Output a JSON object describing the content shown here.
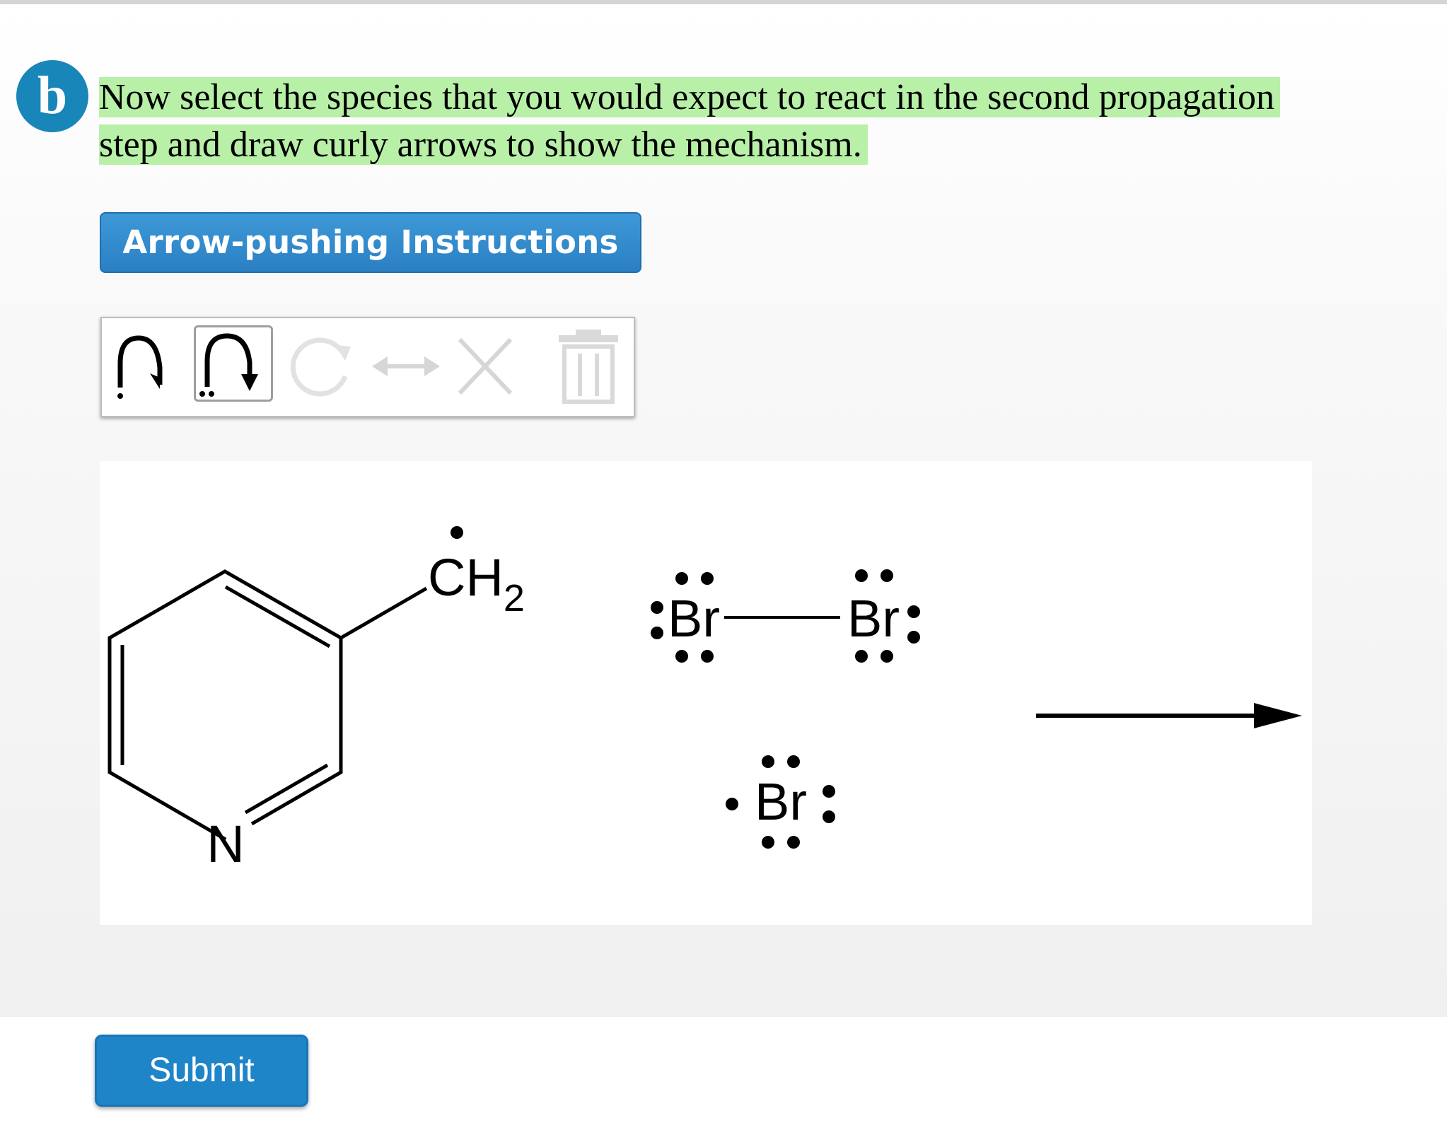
{
  "question": {
    "part_label": "b",
    "prompt_line1": "Now select the species that you would expect to react in the second propagation",
    "prompt_line2": "step and draw curly arrows to show the mechanism.",
    "highlight_color": "#b8f0a8"
  },
  "instructions_button": {
    "label": "Arrow-pushing Instructions"
  },
  "toolbar": {
    "tools": [
      {
        "name": "single-electron-arrow",
        "icon": "fishhook-arrow-icon",
        "enabled": true,
        "selected": false
      },
      {
        "name": "electron-pair-arrow",
        "icon": "curved-arrow-icon",
        "enabled": true,
        "selected": true
      },
      {
        "name": "rotate",
        "icon": "rotate-icon",
        "enabled": false,
        "selected": false
      },
      {
        "name": "resonance",
        "icon": "double-headed-arrow-icon",
        "enabled": false,
        "selected": false
      },
      {
        "name": "delete",
        "icon": "x-icon",
        "enabled": false,
        "selected": false
      },
      {
        "name": "clear",
        "icon": "trash-icon",
        "enabled": false,
        "selected": false
      }
    ]
  },
  "canvas": {
    "species": [
      {
        "name": "3-pyridylmethyl radical",
        "ring_atom": "N",
        "substituent": "CH",
        "substituent_subscript": "2"
      },
      {
        "name": "bromine molecule",
        "atom1": "Br",
        "atom2": "Br"
      },
      {
        "name": "bromine radical",
        "atom": "Br"
      }
    ],
    "reaction_arrow": "right-arrow"
  },
  "submit_button": {
    "label": "Submit"
  },
  "colors": {
    "accent": "#1f85c9",
    "badge": "#1886b8"
  }
}
